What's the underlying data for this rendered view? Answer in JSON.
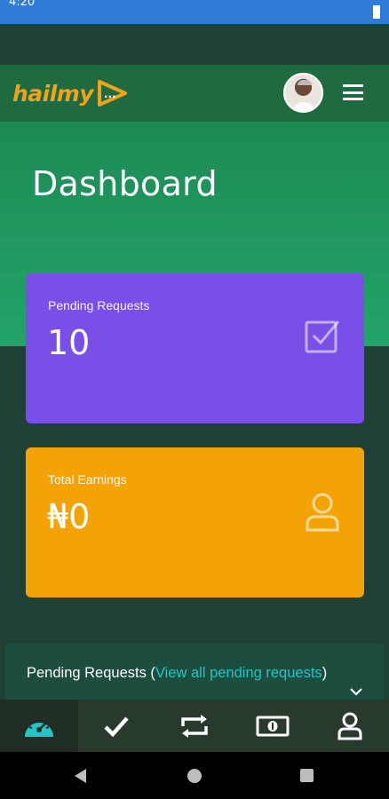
{
  "status_bar": {
    "time": "4:20"
  },
  "header": {
    "logo_text": "hailmy",
    "logo_mark_text": "...",
    "brand_color": "#f0a21b",
    "header_color": "#1f6a3f"
  },
  "hero": {
    "title": "Dashboard"
  },
  "cards": {
    "pending": {
      "label": "Pending Requests",
      "value": "10",
      "icon": "checkbox-icon",
      "color": "#7a4fe8"
    },
    "earnings": {
      "label": "Total Earnings",
      "value": "₦0",
      "icon": "user-icon",
      "color": "#f4a307"
    }
  },
  "panel": {
    "title_prefix": "Pending Requests (",
    "link_text": "View all pending requests",
    "title_suffix": ")"
  },
  "bottom_nav": {
    "items": [
      {
        "icon": "speedometer-icon",
        "active": true
      },
      {
        "icon": "checkmark-icon",
        "active": false
      },
      {
        "icon": "repeat-icon",
        "active": false
      },
      {
        "icon": "cash-icon",
        "active": false
      },
      {
        "icon": "profile-icon",
        "active": false
      }
    ],
    "accent_color": "#23c4c4"
  }
}
